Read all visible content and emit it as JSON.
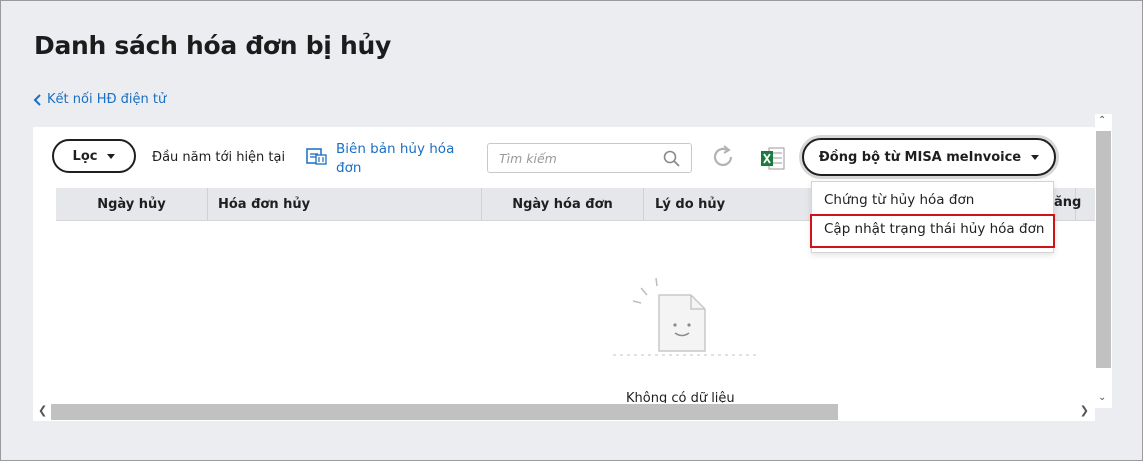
{
  "page": {
    "title": "Danh sách hóa đơn bị hủy",
    "back_link": "Kết nối HĐ điện tử"
  },
  "toolbar": {
    "filter_label": "Lọc",
    "period": "Đầu năm tới hiện tại",
    "report_link": "Biên bản hủy hóa đơn",
    "search_placeholder": "Tìm kiếm",
    "sync_button": "Đồng bộ từ MISA meInvoice"
  },
  "table": {
    "columns": [
      "Ngày hủy",
      "Hóa đơn hủy",
      "Ngày hóa đơn",
      "Lý do hủy",
      "ăng"
    ],
    "rows": [],
    "empty_text": "Không có dữ liệu"
  },
  "dropdown": {
    "items": [
      "Chứng từ hủy hóa đơn",
      "Cập nhật trạng thái hủy hóa đơn"
    ],
    "highlight_color": "#d0121b"
  },
  "colors": {
    "link": "#1a6fc4",
    "excel_green": "#1d7a3e"
  },
  "icons": [
    "chevron-left-icon",
    "caret-down-icon",
    "document-cancel-icon",
    "search-icon",
    "refresh-icon",
    "excel-icon",
    "empty-document-icon"
  ]
}
